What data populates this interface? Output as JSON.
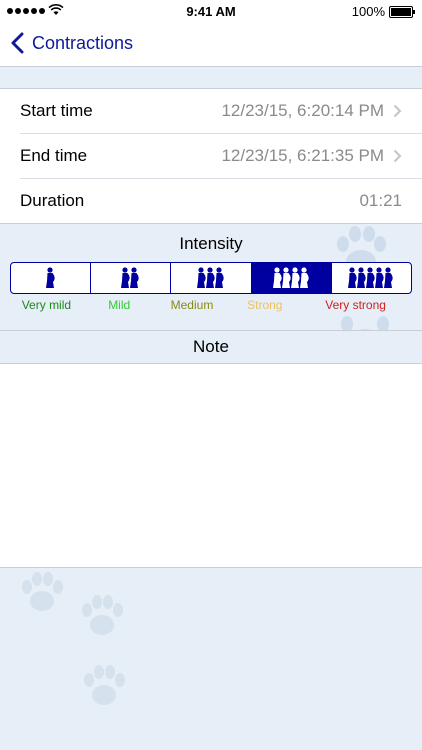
{
  "status_bar": {
    "time": "9:41 AM",
    "battery": "100%"
  },
  "nav": {
    "back_label": "Contractions"
  },
  "rows": [
    {
      "label": "Start time",
      "value": "12/23/15, 6:20:14 PM"
    },
    {
      "label": "End time",
      "value": "12/23/15, 6:21:35 PM"
    },
    {
      "label": "Duration",
      "value": "01:21"
    }
  ],
  "intensity": {
    "title": "Intensity",
    "selected_index": 3,
    "levels": [
      {
        "label": "Very mild",
        "color": "#1a8a1a",
        "figures": 1
      },
      {
        "label": "Mild",
        "color": "#33cc33",
        "figures": 2
      },
      {
        "label": "Medium",
        "color": "#8a8a10",
        "figures": 3
      },
      {
        "label": "Strong",
        "color": "#f0c060",
        "figures": 4
      },
      {
        "label": "Very strong",
        "color": "#d42020",
        "figures": 5
      }
    ]
  },
  "note": {
    "title": "Note",
    "value": ""
  },
  "colors": {
    "accent": "#0e1a9a",
    "segment": "#0000a0",
    "background": "#e6eef8"
  }
}
